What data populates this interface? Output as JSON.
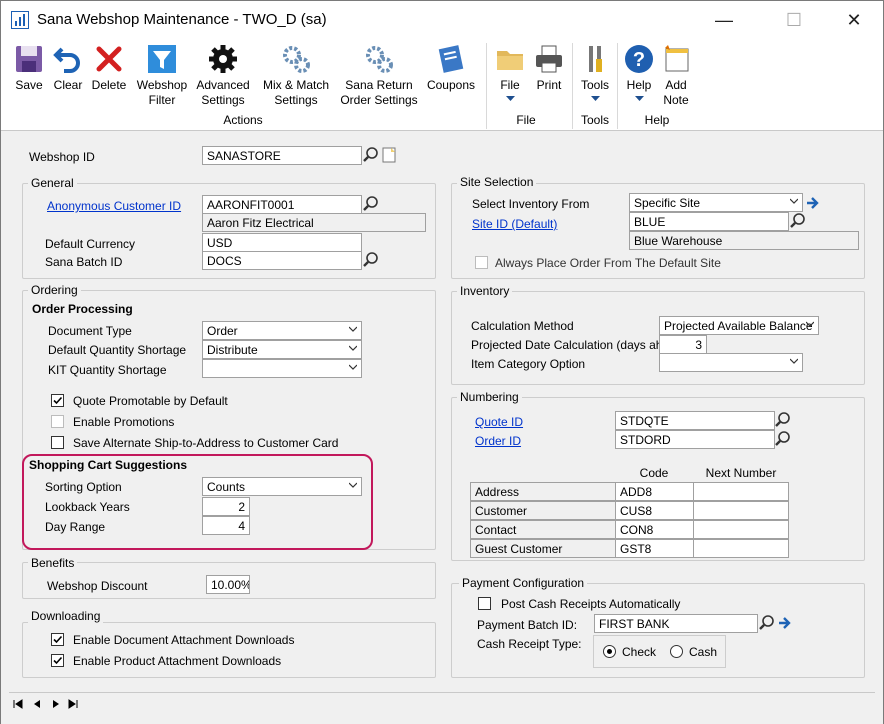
{
  "window": {
    "title": "Sana Webshop Maintenance  -  TWO_D (sa)",
    "minimize": "—",
    "maximize": "☐",
    "close": "✕"
  },
  "ribbon": {
    "buttons": [
      {
        "id": "save",
        "label": "Save"
      },
      {
        "id": "clear",
        "label": "Clear"
      },
      {
        "id": "delete",
        "label": "Delete"
      },
      {
        "id": "webshop_filter",
        "label": "Webshop\nFilter"
      },
      {
        "id": "advanced_settings",
        "label": "Advanced\nSettings"
      },
      {
        "id": "mix_match",
        "label": "Mix & Match\nSettings"
      },
      {
        "id": "sana_return",
        "label": "Sana Return\nOrder Settings"
      },
      {
        "id": "coupons",
        "label": "Coupons"
      },
      {
        "id": "file",
        "label": "File"
      },
      {
        "id": "print",
        "label": "Print"
      },
      {
        "id": "tools",
        "label": "Tools"
      },
      {
        "id": "help",
        "label": "Help"
      },
      {
        "id": "add_note",
        "label": "Add\nNote"
      }
    ],
    "groups": {
      "actions": "Actions",
      "file": "File",
      "tools": "Tools",
      "help": "Help"
    }
  },
  "webshop": {
    "label": "Webshop ID",
    "value": "SANASTORE"
  },
  "general": {
    "title": "General",
    "anon_label": "Anonymous Customer ID",
    "anon_value": "AARONFIT0001",
    "anon_name": "Aaron Fitz Electrical",
    "currency_label": "Default Currency",
    "currency_value": "USD",
    "batch_label": "Sana Batch ID",
    "batch_value": "DOCS"
  },
  "ordering": {
    "title": "Ordering",
    "section": "Order Processing",
    "doc_type_label": "Document Type",
    "doc_type_value": "Order",
    "qty_short_label": "Default Quantity Shortage",
    "qty_short_value": "Distribute",
    "kit_label": "KIT Quantity Shortage",
    "kit_value": "",
    "quote_promotable": "Quote Promotable by Default",
    "enable_promotions": "Enable Promotions",
    "save_alt": "Save Alternate Ship-to-Address to Customer Card"
  },
  "cart": {
    "title": "Shopping Cart Suggestions",
    "sort_label": "Sorting Option",
    "sort_value": "Counts",
    "lookback_label": "Lookback Years",
    "lookback_value": "2",
    "day_label": "Day Range",
    "day_value": "4"
  },
  "benefits": {
    "title": "Benefits",
    "discount_label": "Webshop Discount",
    "discount_value": "10.00%"
  },
  "downloading": {
    "title": "Downloading",
    "doc_attach": "Enable Document Attachment Downloads",
    "prod_attach": "Enable Product Attachment Downloads"
  },
  "site": {
    "title": "Site Selection",
    "inv_label": "Select Inventory From",
    "inv_value": "Specific Site",
    "site_label": "Site ID (Default)",
    "site_value": "BLUE",
    "site_name": "Blue Warehouse",
    "always": "Always Place Order From The Default Site"
  },
  "inventory": {
    "title": "Inventory",
    "calc_label": "Calculation Method",
    "calc_value": "Projected Available Balance",
    "proj_label": "Projected Date Calculation (days ahead)",
    "proj_value": "3",
    "cat_label": "Item Category Option",
    "cat_value": ""
  },
  "numbering": {
    "title": "Numbering",
    "quote_label": "Quote ID",
    "quote_value": "STDQTE",
    "order_label": "Order ID",
    "order_value": "STDORD",
    "col_code": "Code",
    "col_next": "Next Number",
    "rows": [
      {
        "label": "Address",
        "code": "ADD8",
        "next": ""
      },
      {
        "label": "Customer",
        "code": "CUS8",
        "next": ""
      },
      {
        "label": "Contact",
        "code": "CON8",
        "next": ""
      },
      {
        "label": "Guest Customer",
        "code": "GST8",
        "next": ""
      }
    ]
  },
  "payment": {
    "title": "Payment Configuration",
    "post_label": "Post Cash Receipts Automatically",
    "batch_label": "Payment Batch ID:",
    "batch_value": "FIRST BANK",
    "type_label": "Cash Receipt Type:",
    "check": "Check",
    "cash": "Cash"
  }
}
